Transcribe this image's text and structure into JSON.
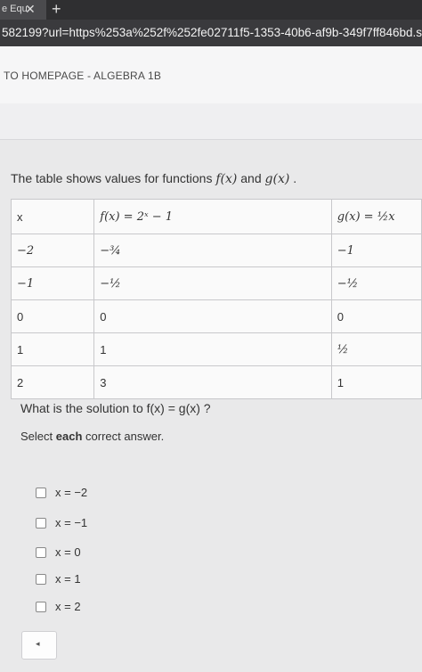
{
  "browser": {
    "tab_label": "e Equ",
    "tab_close": "✕",
    "new_tab": "+",
    "url": "582199?url=https%253a%252f%252fe02711f5-1353-40b6-af9b-349f7ff846bd.sequences.api.b"
  },
  "header": {
    "home_link": "TO HOMEPAGE - ALGEBRA 1B"
  },
  "question": {
    "prompt_text": "The table shows values for functions",
    "f_label": "f(x)",
    "and_text": "and",
    "g_label": "g(x)",
    "period": ".",
    "table": {
      "headers": [
        "x",
        "f(x) = 2ˣ − 1",
        "g(x) = ½x"
      ],
      "rows": [
        [
          "−2",
          "−¾",
          "−1"
        ],
        [
          "−1",
          "−½",
          "−½"
        ],
        [
          "0",
          "0",
          "0"
        ],
        [
          "1",
          "1",
          "½"
        ],
        [
          "2",
          "3",
          "1"
        ]
      ]
    },
    "solution_prompt": "What is the solution to f(x) = g(x) ?",
    "select_prefix": "Select",
    "select_bold": "each",
    "select_suffix": "correct answer."
  },
  "options": [
    "x = −2",
    "x = −1",
    "x = 0",
    "x = 1",
    "x = 2"
  ],
  "nav": {
    "back_icon": "◂"
  }
}
